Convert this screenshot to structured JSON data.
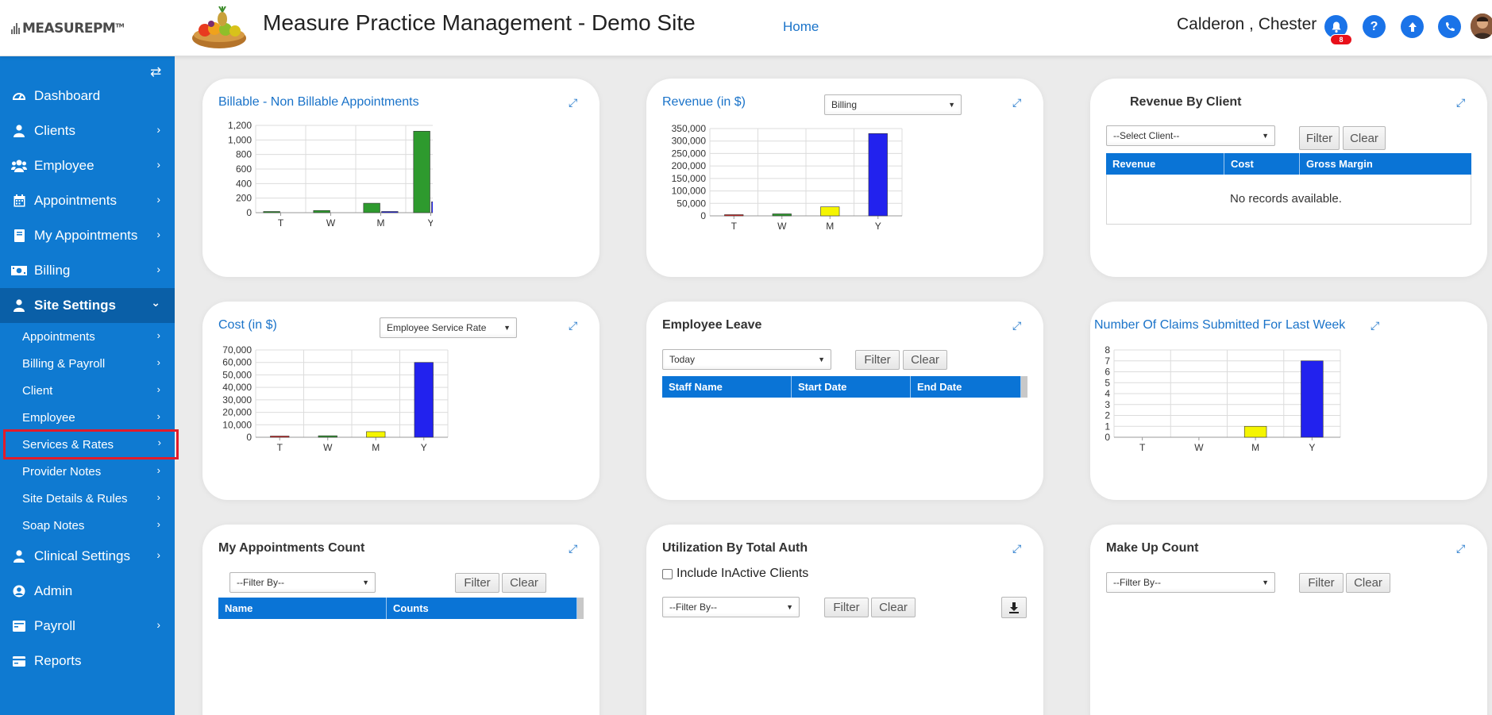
{
  "header": {
    "logo_text": "MEASUREPM",
    "logo_tm": "TM",
    "site_title": "Measure Practice Management - Demo Site",
    "home_link": "Home",
    "user_name": "Calderon , Chester",
    "notification_count": "8"
  },
  "sidebar": {
    "items": [
      {
        "label": "Dashboard",
        "icon": "dashboard-icon"
      },
      {
        "label": "Clients",
        "icon": "user-icon"
      },
      {
        "label": "Employee",
        "icon": "users-icon"
      },
      {
        "label": "Appointments",
        "icon": "calendar-icon"
      },
      {
        "label": "My Appointments",
        "icon": "book-icon"
      },
      {
        "label": "Billing",
        "icon": "money-icon"
      },
      {
        "label": "Site Settings",
        "icon": "user-icon"
      },
      {
        "label": "Clinical Settings",
        "icon": "user-icon"
      },
      {
        "label": "Admin",
        "icon": "user-circle-icon"
      },
      {
        "label": "Payroll",
        "icon": "wallet-icon"
      },
      {
        "label": "Reports",
        "icon": "card-icon"
      }
    ],
    "sub_items": [
      {
        "label": "Appointments"
      },
      {
        "label": "Billing & Payroll"
      },
      {
        "label": "Client"
      },
      {
        "label": "Employee"
      },
      {
        "label": "Services & Rates"
      },
      {
        "label": "Provider Notes"
      },
      {
        "label": "Site Details & Rules"
      },
      {
        "label": "Soap Notes"
      }
    ]
  },
  "cards": {
    "billable": {
      "title": "Billable - Non Billable Appointments"
    },
    "revenue": {
      "title": "Revenue (in $)",
      "select": "Billing"
    },
    "revenue_client": {
      "title": "Revenue By Client",
      "select": "--Select Client--",
      "filter": "Filter",
      "clear": "Clear",
      "columns": [
        "Revenue",
        "Cost",
        "Gross Margin"
      ],
      "empty": "No records available."
    },
    "cost": {
      "title": "Cost (in $)",
      "select": "Employee Service Rate"
    },
    "leave": {
      "title": "Employee Leave",
      "select": "Today",
      "filter": "Filter",
      "clear": "Clear",
      "columns": [
        "Staff Name",
        "Start Date",
        "End Date"
      ]
    },
    "claims": {
      "title": "Number Of Claims Submitted For Last Week"
    },
    "my_appts": {
      "title": "My Appointments Count",
      "select": "--Filter By--",
      "filter": "Filter",
      "clear": "Clear",
      "columns": [
        "Name",
        "Counts"
      ]
    },
    "utilization": {
      "title": "Utilization By Total Auth",
      "checkbox_label": "Include InActive Clients",
      "select": "--Filter By--",
      "filter": "Filter",
      "clear": "Clear"
    },
    "makeup": {
      "title": "Make Up Count",
      "select": "--Filter By--",
      "filter": "Filter",
      "clear": "Clear"
    }
  },
  "chart_data": [
    {
      "id": "billable",
      "type": "bar",
      "categories": [
        "T",
        "W",
        "M",
        "Y"
      ],
      "series": [
        {
          "color": "#2e9a2e",
          "values": [
            10,
            30,
            130,
            1120
          ]
        },
        {
          "color": "#2222ee",
          "values": [
            0,
            0,
            10,
            150
          ]
        }
      ],
      "yticks": [
        "0",
        "200",
        "400",
        "600",
        "800",
        "1,000",
        "1,200"
      ],
      "ylim": [
        0,
        1200
      ]
    },
    {
      "id": "revenue",
      "type": "bar",
      "categories": [
        "T",
        "W",
        "M",
        "Y"
      ],
      "values": [
        2000,
        8000,
        36000,
        330000
      ],
      "colors": [
        "#e0201e",
        "#2e9a2e",
        "#f5f500",
        "#2222ee"
      ],
      "yticks": [
        "0",
        "50,000",
        "100,000",
        "150,000",
        "200,000",
        "250,000",
        "300,000",
        "350,000"
      ],
      "ylim": [
        0,
        350000
      ]
    },
    {
      "id": "cost",
      "type": "bar",
      "categories": [
        "T",
        "W",
        "M",
        "Y"
      ],
      "values": [
        500,
        1200,
        4500,
        60000
      ],
      "colors": [
        "#e0201e",
        "#2e9a2e",
        "#f5f500",
        "#2222ee"
      ],
      "yticks": [
        "0",
        "10,000",
        "20,000",
        "30,000",
        "40,000",
        "50,000",
        "60,000",
        "70,000"
      ],
      "ylim": [
        0,
        70000
      ]
    },
    {
      "id": "claims",
      "type": "bar",
      "categories": [
        "T",
        "W",
        "M",
        "Y"
      ],
      "values": [
        0,
        0,
        1,
        7
      ],
      "colors": [
        "#e0201e",
        "#2e9a2e",
        "#f5f500",
        "#2222ee"
      ],
      "yticks": [
        "0",
        "1",
        "2",
        "3",
        "4",
        "5",
        "6",
        "7",
        "8"
      ],
      "ylim": [
        0,
        8
      ]
    }
  ]
}
